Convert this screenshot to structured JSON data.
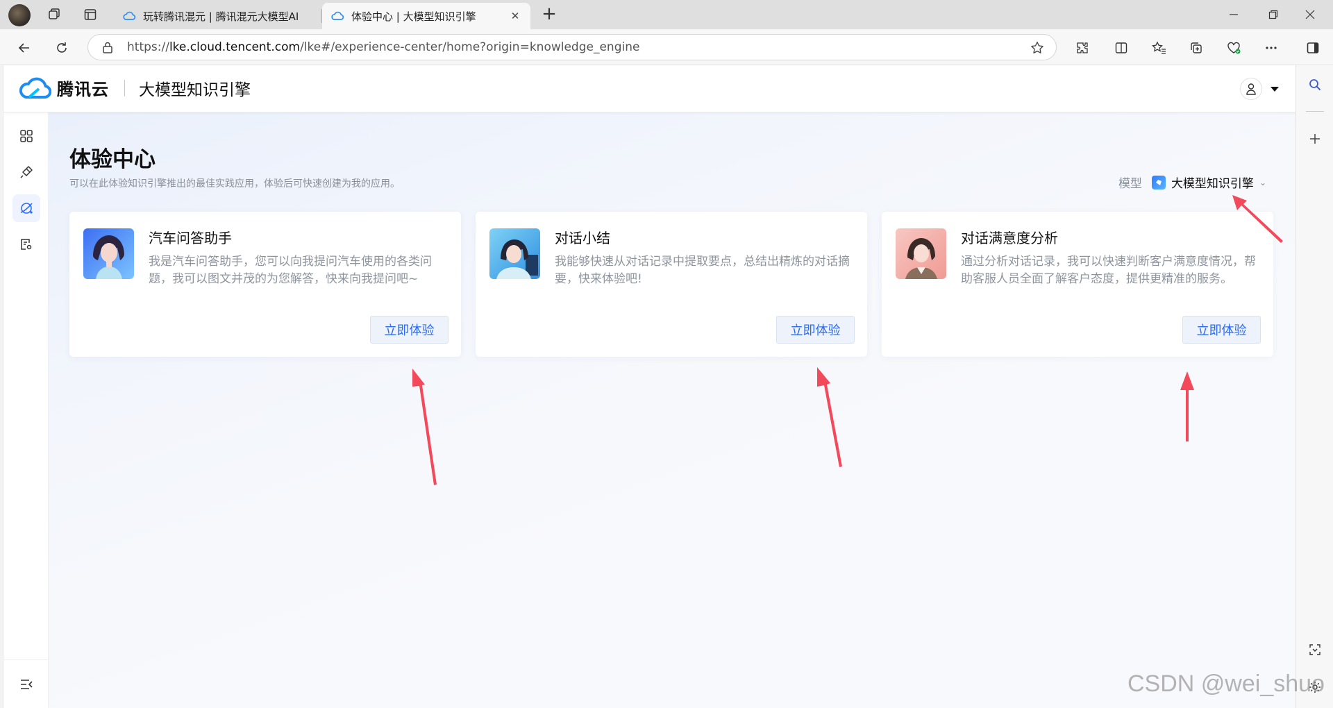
{
  "browser": {
    "tabs": [
      {
        "title": "玩转腾讯混元 | 腾讯混元大模型AI",
        "active": false
      },
      {
        "title": "体验中心 | 大模型知识引擎",
        "active": true
      }
    ],
    "url_prefix": "https://",
    "url_host": "lke.cloud.tencent.com",
    "url_path": "/lke#/experience-center/home?origin=knowledge_engine"
  },
  "header": {
    "brand": "腾讯云",
    "product": "大模型知识引擎"
  },
  "main": {
    "title": "体验中心",
    "subtitle": "可以在此体验知识引擎推出的最佳实践应用，体验后可快速创建为我的应用。",
    "model_label": "模型",
    "model_value": "大模型知识引擎"
  },
  "cards": [
    {
      "title": "汽车问答助手",
      "desc": "我是汽车问答助手，您可以向我提问汽车使用的各类问题，我可以图文并茂的为您解答，快来向我提问吧~",
      "button": "立即体验"
    },
    {
      "title": "对话小结",
      "desc": "我能够快速从对话记录中提取要点，总结出精炼的对话摘要，快来体验吧!",
      "button": "立即体验"
    },
    {
      "title": "对话满意度分析",
      "desc": "通过分析对话记录，我可以快速判断客户满意度情况，帮助客服人员全面了解客户态度，提供更精准的服务。",
      "button": "立即体验"
    }
  ],
  "watermark": "CSDN @wei_shuo",
  "colors": {
    "accent": "#2a6cf6",
    "annotation_arrow": "#f2495b"
  }
}
